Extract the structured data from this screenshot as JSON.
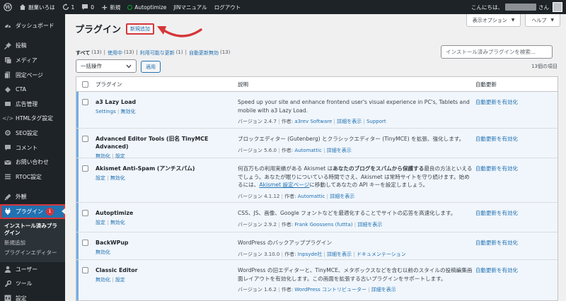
{
  "admin_bar": {
    "site_name": "副業いろは",
    "updates_count": "1",
    "comments_count": "0",
    "new_label": "新規",
    "autoptimize_label": "Autoptimize",
    "manual_label": "JINマニュアル",
    "logout_label": "ログアウト",
    "greeting_prefix": "こんにちは、",
    "greeting_suffix": "さん",
    "status_color": "#00a32a"
  },
  "sidebar": {
    "items": [
      {
        "label": "ダッシュボード",
        "icon": "dashboard-icon"
      },
      {
        "label": "投稿",
        "icon": "pin-icon"
      },
      {
        "label": "メディア",
        "icon": "media-icon"
      },
      {
        "label": "固定ページ",
        "icon": "page-icon"
      },
      {
        "label": "CTA",
        "icon": "cta-icon"
      },
      {
        "label": "広告管理",
        "icon": "ad-icon"
      },
      {
        "label": "HTMLタグ設定",
        "icon": "code-icon"
      },
      {
        "label": "SEO設定",
        "icon": "seo-icon"
      },
      {
        "label": "コメント",
        "icon": "comment-icon"
      },
      {
        "label": "お問い合わせ",
        "icon": "mail-icon"
      },
      {
        "label": "RTOC設定",
        "icon": "toc-icon"
      },
      {
        "label": "外観",
        "icon": "appearance-icon"
      },
      {
        "label": "プラグイン",
        "icon": "plugin-icon",
        "badge": "1"
      }
    ],
    "plugins_submenu": [
      {
        "label": "インストール済みプラグイン"
      },
      {
        "label": "新規追加"
      },
      {
        "label": "プラグインエディター"
      }
    ],
    "lower_items": [
      {
        "label": "ユーザー",
        "icon": "user-icon"
      },
      {
        "label": "ツール",
        "icon": "tools-icon"
      },
      {
        "label": "設定",
        "icon": "settings-icon"
      }
    ],
    "accent_color": "#2271b1",
    "highlight_color": "#d63638"
  },
  "header": {
    "title": "プラグイン",
    "add_new_label": "新規追加",
    "screen_options_label": "表示オプション",
    "help_label": "ヘルプ"
  },
  "filters": {
    "all": {
      "label": "すべて",
      "count": "(13)"
    },
    "active": {
      "label": "使用中",
      "count": "(13)"
    },
    "updates": {
      "label": "利用可能な更新",
      "count": "(1)"
    },
    "autoupdate_disabled": {
      "label": "自動更新無効",
      "count": "(13)"
    }
  },
  "search": {
    "placeholder": "インストール済みプラグインを検索..."
  },
  "bulk": {
    "selected": "一括操作",
    "apply_label": "適用"
  },
  "item_count": "13個の項目",
  "table": {
    "headers": {
      "plugin": "プラグイン",
      "description": "説明",
      "auto_update": "自動更新"
    },
    "rows": [
      {
        "name": "a3 Lazy Load",
        "actions": [
          "Settings",
          "無効化"
        ],
        "description": "Speed up your site and enhance frontend user's visual experience in PC's, Tablets and mobile with a3 Lazy Load.",
        "version": "バージョン 2.4.7",
        "author_label": "作者:",
        "author": "a3rev Software",
        "links": [
          "詳細を表示",
          "Support"
        ],
        "auto_update": "自動更新を有効化"
      },
      {
        "name": "Advanced Editor Tools (旧名 TinyMCE Advanced)",
        "actions": [
          "無効化",
          "設定"
        ],
        "description": "ブロックエディター (Gutenberg) とクラシックエディター (TinyMCE) を拡張、強化します。",
        "version": "バージョン 5.6.0",
        "author_label": "作者:",
        "author": "Automattic",
        "links": [
          "詳細を表示"
        ],
        "auto_update": "自動更新を有効化"
      },
      {
        "name": "Akismet Anti-Spam (アンチスパム)",
        "actions": [
          "設定",
          "無効化"
        ],
        "description_parts": {
          "a": "何百万もの利用実績がある Akismet は",
          "b": "あなたのブログをスパムから保護する",
          "c": "最良の方法といえるでしょう。あなたが眠りについている時間でさえ、Akismet は常時サイトを守り続けます。始めるには、",
          "link": "Akismet 設定ページ",
          "d": "に移動してあなたの API キーを設定しましょう。"
        },
        "version": "バージョン 4.1.12",
        "author_label": "作者:",
        "author": "Automattic",
        "links": [
          "詳細を表示"
        ],
        "auto_update": "自動更新を有効化"
      },
      {
        "name": "Autoptimize",
        "actions": [
          "設定",
          "無効化"
        ],
        "description": "CSS、JS、画像、Google フォントなどを最適化することでサイトの応答を高速化します。",
        "version": "バージョン 2.9.2",
        "author_label": "作者:",
        "author": "Frank Goossens (futtta)",
        "links": [
          "詳細を表示"
        ],
        "auto_update": "自動更新を有効化"
      },
      {
        "name": "BackWPup",
        "actions": [
          "無効化"
        ],
        "description": "WordPress のバックアッププラグイン",
        "version": "バージョン 3.10.0",
        "author_label": "作者:",
        "author": "Inpsyde社",
        "links": [
          "詳細を表示",
          "ドキュメンテーション"
        ],
        "auto_update": "自動更新を有効化"
      },
      {
        "name": "Classic Editor",
        "actions": [
          "無効化",
          "設定"
        ],
        "description": "WordPress の旧エディターと、TinyMCE、メタボックスなどを含む以前のスタイルの投稿編集画面レイアウトを有効化します。この画面を拡張する古いプラグインをサポートします。",
        "version": "バージョン 1.6.2",
        "author_label": "作者:",
        "author": "WordPress コントリビューター",
        "links": [
          "詳細を表示"
        ],
        "auto_update": "自動更新を有効化"
      }
    ]
  }
}
